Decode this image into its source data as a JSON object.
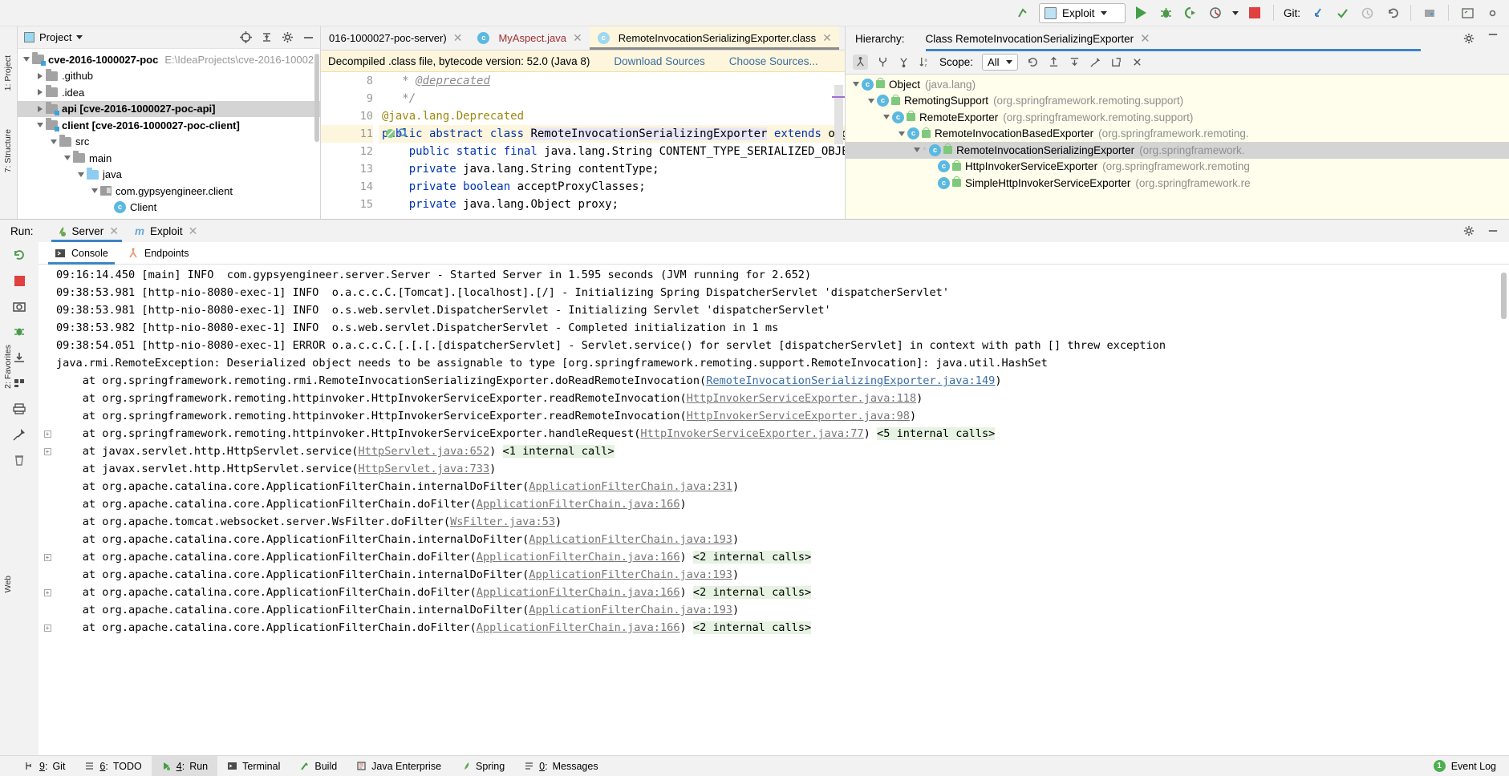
{
  "toolbar": {
    "run_config": "Exploit",
    "git_label": "Git:",
    "icons": [
      "vcs-updown-icon",
      "run-config-selector",
      "run-icon",
      "debug-icon",
      "run-coverage-icon",
      "profile-icon",
      "stop-icon",
      "update-project-icon",
      "commit-icon",
      "history-icon",
      "rollback-icon",
      "project-structure-icon",
      "terminal-icon",
      "settings-icon"
    ]
  },
  "project_panel": {
    "title": "Project",
    "rail_top": "1: Project",
    "rail_mid": "7: Structure",
    "items": [
      {
        "label": "cve-2016-1000027-poc",
        "path": "E:\\IdeaProjects\\cve-2016-10002",
        "indent": 0,
        "arrow": "down",
        "icon": "module-folder",
        "bold": true,
        "selected": false
      },
      {
        "label": ".github",
        "path": "",
        "indent": 1,
        "arrow": "right",
        "icon": "folder",
        "bold": false,
        "selected": false
      },
      {
        "label": ".idea",
        "path": "",
        "indent": 1,
        "arrow": "right",
        "icon": "folder",
        "bold": false,
        "selected": false
      },
      {
        "label": "api [cve-2016-1000027-poc-api]",
        "path": "",
        "indent": 1,
        "arrow": "right",
        "icon": "module-folder",
        "bold": true,
        "selected": true
      },
      {
        "label": "client [cve-2016-1000027-poc-client]",
        "path": "",
        "indent": 1,
        "arrow": "down",
        "icon": "module-folder",
        "bold": true,
        "selected": false
      },
      {
        "label": "src",
        "path": "",
        "indent": 2,
        "arrow": "down",
        "icon": "folder",
        "bold": false,
        "selected": false
      },
      {
        "label": "main",
        "path": "",
        "indent": 3,
        "arrow": "down",
        "icon": "folder",
        "bold": false,
        "selected": false
      },
      {
        "label": "java",
        "path": "",
        "indent": 4,
        "arrow": "down",
        "icon": "source-folder",
        "bold": false,
        "selected": false
      },
      {
        "label": "com.gypsyengineer.client",
        "path": "",
        "indent": 5,
        "arrow": "down",
        "icon": "package",
        "bold": false,
        "selected": false
      },
      {
        "label": "Client",
        "path": "",
        "indent": 6,
        "arrow": "none",
        "icon": "java-class",
        "bold": false,
        "selected": false
      }
    ]
  },
  "editor": {
    "tabs": [
      {
        "label": "016-1000027-poc-server)",
        "icon": "none",
        "active": false,
        "red": false
      },
      {
        "label": "MyAspect.java",
        "icon": "java-class",
        "active": false,
        "red": true
      },
      {
        "label": "RemoteInvocationSerializingExporter.class",
        "icon": "class-file",
        "active": true,
        "red": false
      }
    ],
    "notice": "Decompiled .class file, bytecode version: 52.0 (Java 8)",
    "notice_link1": "Download Sources",
    "notice_link2": "Choose Sources...",
    "lines": [
      {
        "num": "8",
        "gutter_icons": false,
        "highlight": false,
        "indent": "   ",
        "segments": [
          {
            "t": "* ",
            "c": "cmt"
          },
          {
            "t": "@deprecated",
            "c": "cmt-u"
          }
        ]
      },
      {
        "num": "9",
        "gutter_icons": false,
        "highlight": false,
        "indent": "   ",
        "segments": [
          {
            "t": "*/",
            "c": "cmt"
          }
        ]
      },
      {
        "num": "10",
        "gutter_icons": false,
        "highlight": false,
        "indent": "",
        "segments": [
          {
            "t": "@java.lang.Deprecated",
            "c": "ann"
          }
        ]
      },
      {
        "num": "11",
        "gutter_icons": true,
        "highlight": true,
        "indent": "",
        "segments": [
          {
            "t": "public abstract class ",
            "c": "kw"
          },
          {
            "t": "RemoteInvocationSerializingExporter",
            "c": "cname"
          },
          {
            "t": " ",
            "c": ""
          },
          {
            "t": "extends",
            "c": "kw"
          },
          {
            "t": " org",
            "c": ""
          }
        ]
      },
      {
        "num": "12",
        "gutter_icons": false,
        "highlight": false,
        "indent": "    ",
        "segments": [
          {
            "t": "public static final ",
            "c": "kw"
          },
          {
            "t": "java.lang.String CONTENT_TYPE_SERIALIZED_OBJE",
            "c": ""
          }
        ]
      },
      {
        "num": "13",
        "gutter_icons": false,
        "highlight": false,
        "indent": "    ",
        "segments": [
          {
            "t": "private ",
            "c": "kw"
          },
          {
            "t": "java.lang.String contentType;",
            "c": ""
          }
        ]
      },
      {
        "num": "14",
        "gutter_icons": false,
        "highlight": false,
        "indent": "    ",
        "segments": [
          {
            "t": "private boolean ",
            "c": "kw"
          },
          {
            "t": "acceptProxyClasses;",
            "c": ""
          }
        ]
      },
      {
        "num": "15",
        "gutter_icons": false,
        "highlight": false,
        "indent": "    ",
        "segments": [
          {
            "t": "private ",
            "c": "kw"
          },
          {
            "t": "java.lang.Object proxy;",
            "c": ""
          }
        ]
      }
    ]
  },
  "hierarchy": {
    "label": "Hierarchy:",
    "title": "Class RemoteInvocationSerializingExporter",
    "scope_label": "Scope:",
    "scope_value": "All",
    "tool_icons": [
      "type-hierarchy-icon",
      "supertype-hierarchy-icon",
      "subtype-hierarchy-icon",
      "sort-alphabetically-icon",
      "refresh-icon",
      "export-icon",
      "expand-icon",
      "settings-icon",
      "close-icon"
    ],
    "rows": [
      {
        "name": "Object",
        "pkg": "(java.lang)",
        "indent": 0,
        "arrow": "down",
        "selected": false,
        "star": false
      },
      {
        "name": "RemotingSupport",
        "pkg": "(org.springframework.remoting.support)",
        "indent": 1,
        "arrow": "down",
        "selected": false,
        "star": false
      },
      {
        "name": "RemoteExporter",
        "pkg": "(org.springframework.remoting.support)",
        "indent": 2,
        "arrow": "down",
        "selected": false,
        "star": false
      },
      {
        "name": "RemoteInvocationBasedExporter",
        "pkg": "(org.springframework.remoting.",
        "indent": 3,
        "arrow": "down",
        "selected": false,
        "star": false
      },
      {
        "name": "RemoteInvocationSerializingExporter",
        "pkg": "(org.springframework.",
        "indent": 4,
        "arrow": "down",
        "selected": true,
        "star": true
      },
      {
        "name": "HttpInvokerServiceExporter",
        "pkg": "(org.springframework.remoting",
        "indent": 5,
        "arrow": "none",
        "selected": false,
        "star": false
      },
      {
        "name": "SimpleHttpInvokerServiceExporter",
        "pkg": "(org.springframework.re",
        "indent": 5,
        "arrow": "none",
        "selected": false,
        "star": false
      }
    ]
  },
  "run_panel": {
    "run_label": "Run:",
    "tabs": [
      {
        "label": "Server",
        "icon": "spring-boot-icon",
        "active": true
      },
      {
        "label": "Exploit",
        "icon": "maven-icon",
        "active": false
      }
    ],
    "subtabs": [
      {
        "label": "Console",
        "icon": "console-icon",
        "active": true
      },
      {
        "label": "Endpoints",
        "icon": "endpoints-icon",
        "active": false
      }
    ],
    "gutter_icons": [
      "rerun-icon",
      "stop-icon",
      "screenshot-icon",
      "thread-dump-icon",
      "export-icon",
      "scroll-up-icon",
      "scroll-down-icon",
      "soft-wrap-icon",
      "print-icon",
      "clear-all-icon",
      "pin-icon"
    ],
    "console_lines": [
      {
        "text": "09:16:14.450 [main] INFO  com.gypsyengineer.server.Server - Started Server in 1.595 seconds (JVM running for 2.652)",
        "fold": false
      },
      {
        "text": "09:38:53.981 [http-nio-8080-exec-1] INFO  o.a.c.c.C.[Tomcat].[localhost].[/] - Initializing Spring DispatcherServlet 'dispatcherServlet'",
        "fold": false
      },
      {
        "text": "09:38:53.981 [http-nio-8080-exec-1] INFO  o.s.web.servlet.DispatcherServlet - Initializing Servlet 'dispatcherServlet'",
        "fold": false
      },
      {
        "text": "09:38:53.982 [http-nio-8080-exec-1] INFO  o.s.web.servlet.DispatcherServlet - Completed initialization in 1 ms",
        "fold": false
      },
      {
        "text": "09:38:54.051 [http-nio-8080-exec-1] ERROR o.a.c.c.C.[.[.[.[dispatcherServlet] - Servlet.service() for servlet [dispatcherServlet] in context with path [] threw exception",
        "fold": false
      },
      {
        "text": "java.rmi.RemoteException: Deserialized object needs to be assignable to type [org.springframework.remoting.support.RemoteInvocation]: java.util.HashSet",
        "fold": false
      },
      {
        "prefix": "    at org.springframework.remoting.rmi.RemoteInvocationSerializingExporter.doReadRemoteInvocation(",
        "link": "RemoteInvocationSerializingExporter.java:149",
        "link_style": "blue",
        "suffix": ")",
        "note": "",
        "fold": false
      },
      {
        "prefix": "    at org.springframework.remoting.httpinvoker.HttpInvokerServiceExporter.readRemoteInvocation(",
        "link": "HttpInvokerServiceExporter.java:118",
        "link_style": "gray",
        "suffix": ")",
        "note": "",
        "fold": false
      },
      {
        "prefix": "    at org.springframework.remoting.httpinvoker.HttpInvokerServiceExporter.readRemoteInvocation(",
        "link": "HttpInvokerServiceExporter.java:98",
        "link_style": "gray",
        "suffix": ")",
        "note": "",
        "fold": false
      },
      {
        "prefix": "    at org.springframework.remoting.httpinvoker.HttpInvokerServiceExporter.handleRequest(",
        "link": "HttpInvokerServiceExporter.java:77",
        "link_style": "gray",
        "suffix": ")",
        "note": "<5 internal calls>",
        "fold": true
      },
      {
        "prefix": "    at javax.servlet.http.HttpServlet.service(",
        "link": "HttpServlet.java:652",
        "link_style": "gray",
        "suffix": ")",
        "note": "<1 internal call>",
        "fold": true
      },
      {
        "prefix": "    at javax.servlet.http.HttpServlet.service(",
        "link": "HttpServlet.java:733",
        "link_style": "gray",
        "suffix": ")",
        "note": "",
        "fold": false
      },
      {
        "prefix": "    at org.apache.catalina.core.ApplicationFilterChain.internalDoFilter(",
        "link": "ApplicationFilterChain.java:231",
        "link_style": "gray",
        "suffix": ")",
        "note": "",
        "fold": false
      },
      {
        "prefix": "    at org.apache.catalina.core.ApplicationFilterChain.doFilter(",
        "link": "ApplicationFilterChain.java:166",
        "link_style": "gray",
        "suffix": ")",
        "note": "",
        "fold": false
      },
      {
        "prefix": "    at org.apache.tomcat.websocket.server.WsFilter.doFilter(",
        "link": "WsFilter.java:53",
        "link_style": "gray",
        "suffix": ")",
        "note": "",
        "fold": false
      },
      {
        "prefix": "    at org.apache.catalina.core.ApplicationFilterChain.internalDoFilter(",
        "link": "ApplicationFilterChain.java:193",
        "link_style": "gray",
        "suffix": ")",
        "note": "",
        "fold": false
      },
      {
        "prefix": "    at org.apache.catalina.core.ApplicationFilterChain.doFilter(",
        "link": "ApplicationFilterChain.java:166",
        "link_style": "gray",
        "suffix": ")",
        "note": "<2 internal calls>",
        "fold": true
      },
      {
        "prefix": "    at org.apache.catalina.core.ApplicationFilterChain.internalDoFilter(",
        "link": "ApplicationFilterChain.java:193",
        "link_style": "gray",
        "suffix": ")",
        "note": "",
        "fold": false
      },
      {
        "prefix": "    at org.apache.catalina.core.ApplicationFilterChain.doFilter(",
        "link": "ApplicationFilterChain.java:166",
        "link_style": "gray",
        "suffix": ")",
        "note": "<2 internal calls>",
        "fold": true
      },
      {
        "prefix": "    at org.apache.catalina.core.ApplicationFilterChain.internalDoFilter(",
        "link": "ApplicationFilterChain.java:193",
        "link_style": "gray",
        "suffix": ")",
        "note": "",
        "fold": false
      },
      {
        "prefix": "    at org.apache.catalina.core.ApplicationFilterChain.doFilter(",
        "link": "ApplicationFilterChain.java:166",
        "link_style": "gray",
        "suffix": ")",
        "note": "<2 internal calls>",
        "fold": true
      }
    ]
  },
  "status_bar": {
    "items": [
      {
        "num": "9",
        "label": "Git",
        "icon": "git-icon",
        "active": false
      },
      {
        "num": "6",
        "label": "TODO",
        "icon": "todo-icon",
        "active": false
      },
      {
        "num": "4",
        "label": "Run",
        "icon": "run-icon",
        "active": true
      },
      {
        "num": "",
        "label": "Terminal",
        "icon": "terminal-icon",
        "active": false
      },
      {
        "num": "",
        "label": "Build",
        "icon": "build-icon",
        "active": false
      },
      {
        "num": "",
        "label": "Java Enterprise",
        "icon": "java-enterprise-icon",
        "active": false
      },
      {
        "num": "",
        "label": "Spring",
        "icon": "spring-icon",
        "active": false
      },
      {
        "num": "0",
        "label": "Messages",
        "icon": "messages-icon",
        "active": false
      }
    ],
    "event_log": "Event Log",
    "event_count": "1"
  },
  "left_rails": {
    "favorites": "2: Favorites",
    "web": "Web"
  }
}
